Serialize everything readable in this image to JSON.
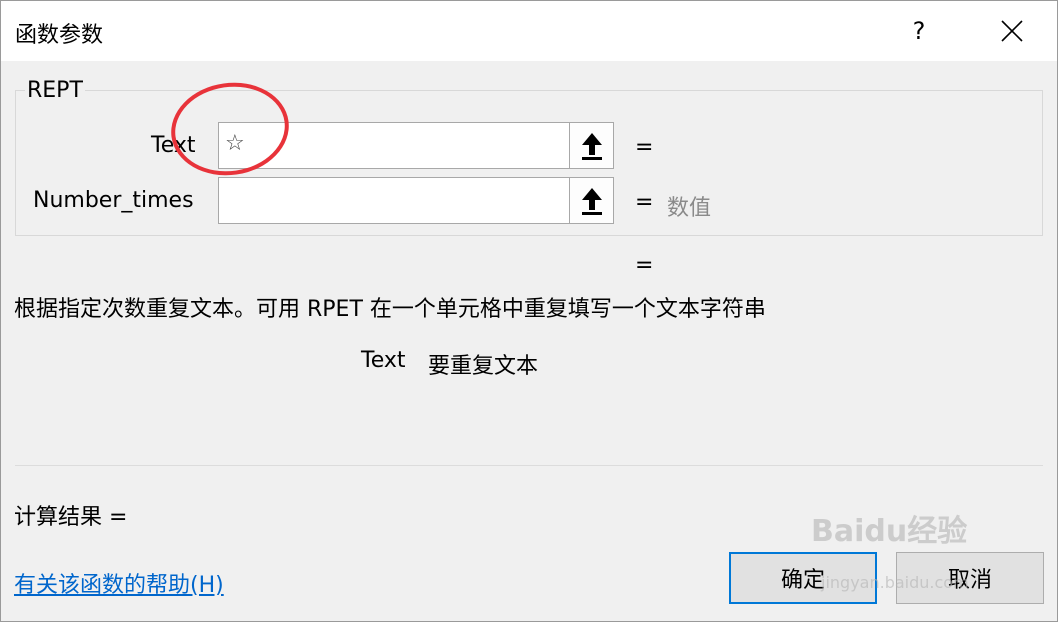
{
  "window": {
    "title": "函数参数",
    "help_label": "?"
  },
  "function": {
    "name": "REPT",
    "args": [
      {
        "label": "Text",
        "value": "☆",
        "result": ""
      },
      {
        "label": "Number_times",
        "value": "",
        "result": "数值"
      }
    ],
    "equals": "=",
    "result_equals": "=",
    "description": "根据指定次数重复文本。可用 RPET 在一个单元格中重复填写一个文本字符串",
    "param_name": "Text",
    "param_description": "要重复文本",
    "calc_result_label": "计算结果 ="
  },
  "footer": {
    "help_link": "有关该函数的帮助(H)",
    "ok_label": "确定",
    "cancel_label": "取消"
  },
  "watermark": {
    "brand": "Baidu经验",
    "url": "jingyan.baidu.com"
  },
  "colors": {
    "accent": "#0078d7",
    "link": "#0066cc",
    "annotation": "#e8333a"
  }
}
